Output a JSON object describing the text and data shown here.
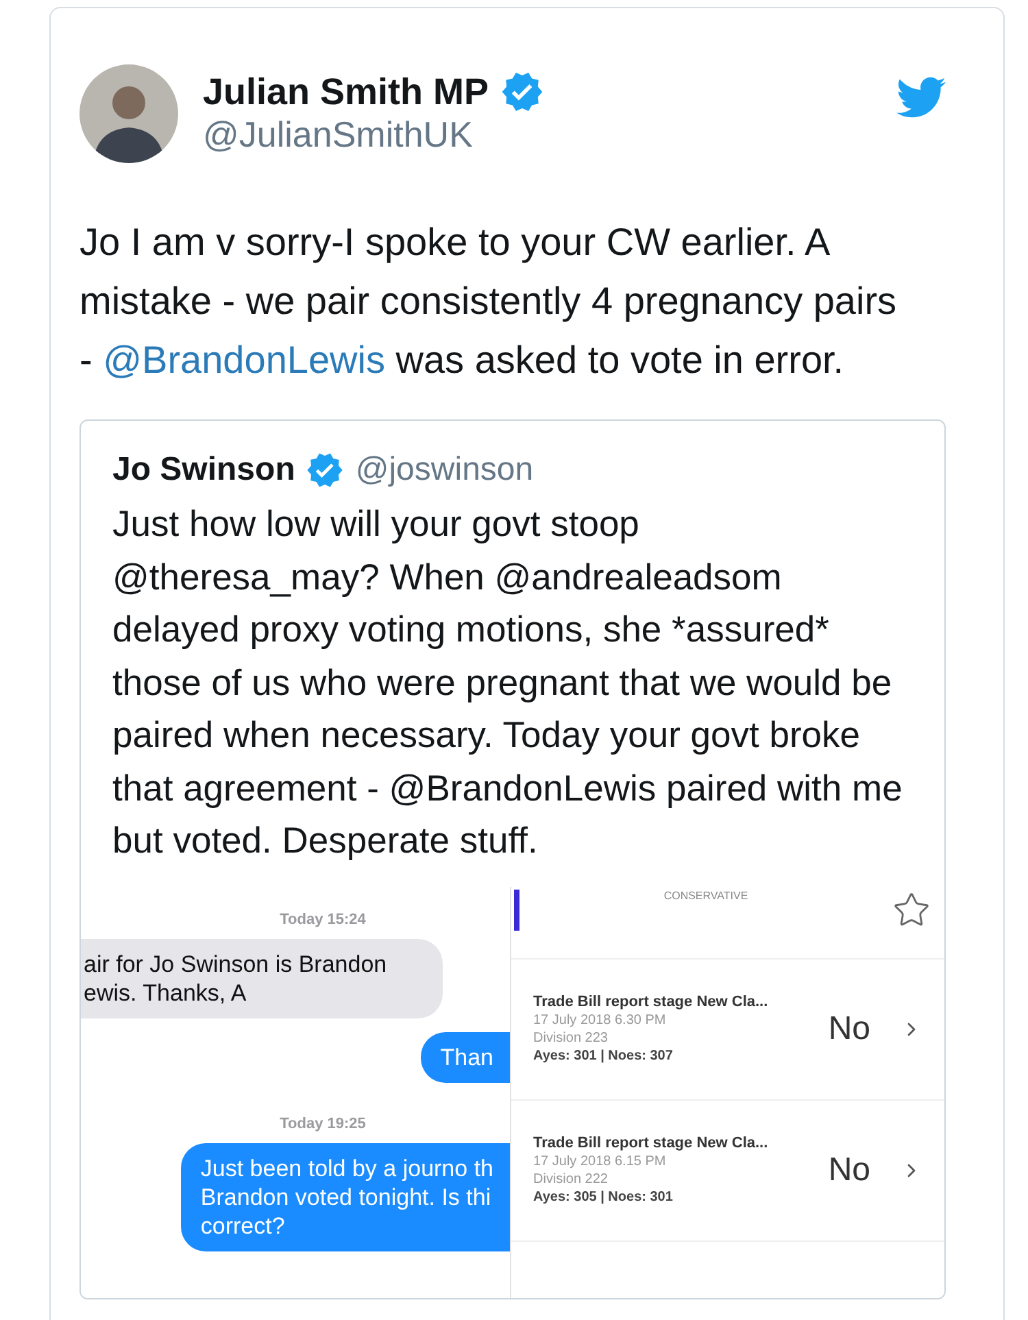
{
  "tweet": {
    "author": {
      "name": "Julian Smith MP",
      "handle": "@JulianSmithUK",
      "verified": true
    },
    "body": [
      {
        "kind": "text",
        "text": "Jo I am v sorry-I spoke to your CW earlier. A mistake - we pair consistently 4 pregnancy pairs - "
      },
      {
        "kind": "mention",
        "text": "@BrandonLewis"
      },
      {
        "kind": "text",
        "text": " was asked to vote in error."
      }
    ]
  },
  "quoted_tweet": {
    "author": {
      "name": "Jo Swinson",
      "handle": "@joswinson",
      "verified": true
    },
    "body": "Just how low will your govt stoop @theresa_may? When @andrealeadsom delayed proxy voting motions, she *assured* those of us who were pregnant that we would be paired when necessary. Today your govt broke that agreement - @BrandonLewis paired with me but voted. Desperate stuff.",
    "attached_image": {
      "messages": [
        {
          "kind": "timestamp",
          "text": "Today 15:24"
        },
        {
          "kind": "received",
          "text": "air for Jo Swinson is Brandon\newis. Thanks, A"
        },
        {
          "kind": "sent",
          "text": "Than"
        },
        {
          "kind": "timestamp",
          "text": "Today 19:25"
        },
        {
          "kind": "sent",
          "text": "Just been told by a journo th\nBrandon voted tonight. Is thi\ncorrect?"
        }
      ],
      "votes_app": {
        "header": "CONSERVATIVE",
        "starred": false,
        "rows": [
          {
            "title": "Trade Bill report stage New Cla...",
            "date": "17 July 2018 6.30 PM",
            "division": "Division 223",
            "tally": "Ayes: 301 | Noes: 307",
            "vote": "No"
          },
          {
            "title": "Trade Bill report stage New Cla...",
            "date": "17 July 2018 6.15 PM",
            "division": "Division 222",
            "tally": "Ayes: 305 | Noes: 301",
            "vote": "No"
          }
        ]
      }
    }
  }
}
